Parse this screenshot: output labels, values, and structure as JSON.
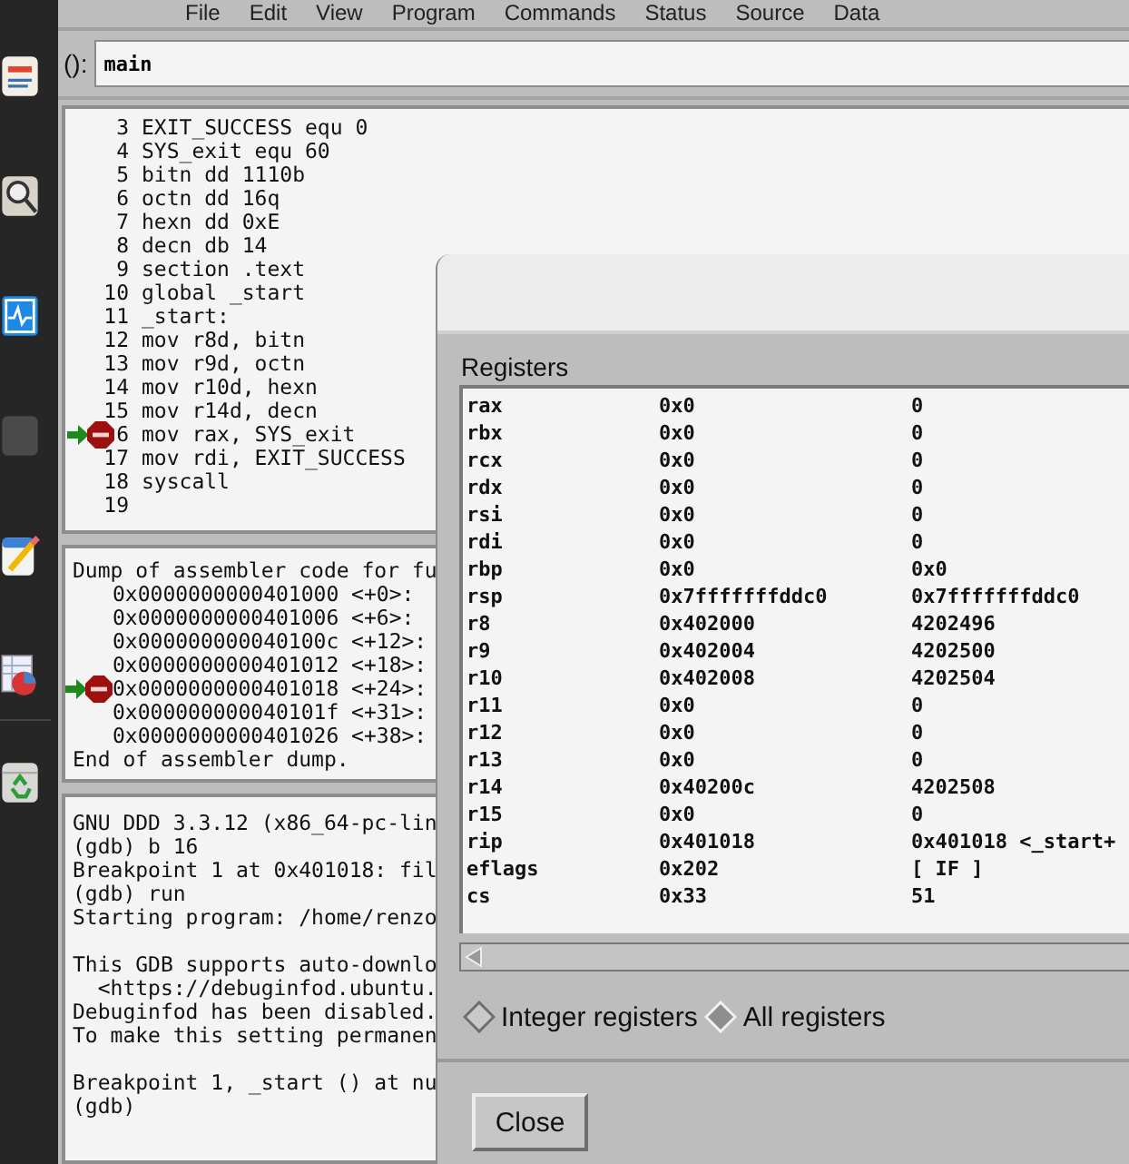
{
  "menu_bar": [
    "File",
    "Edit",
    "View",
    "Program",
    "Commands",
    "Status",
    "Source",
    "Data"
  ],
  "argument_field": {
    "label": "():",
    "value": "main"
  },
  "source_lines": [
    {
      "number": "3",
      "code": "EXIT_SUCCESS equ 0",
      "breakpoint": false,
      "current": false
    },
    {
      "number": "4",
      "code": "SYS_exit equ 60",
      "breakpoint": false,
      "current": false
    },
    {
      "number": "5",
      "code": "bitn dd 1110b",
      "breakpoint": false,
      "current": false
    },
    {
      "number": "6",
      "code": "octn dd 16q",
      "breakpoint": false,
      "current": false
    },
    {
      "number": "7",
      "code": "hexn dd 0xE",
      "breakpoint": false,
      "current": false
    },
    {
      "number": "8",
      "code": "decn db 14",
      "breakpoint": false,
      "current": false
    },
    {
      "number": "9",
      "code": "section .text",
      "breakpoint": false,
      "current": false
    },
    {
      "number": "10",
      "code": "global _start",
      "breakpoint": false,
      "current": false
    },
    {
      "number": "11",
      "code": "_start:",
      "breakpoint": false,
      "current": false
    },
    {
      "number": "12",
      "code": "mov r8d, bitn",
      "breakpoint": false,
      "current": false
    },
    {
      "number": "13",
      "code": "mov r9d, octn",
      "breakpoint": false,
      "current": false
    },
    {
      "number": "14",
      "code": "mov r10d, hexn",
      "breakpoint": false,
      "current": false
    },
    {
      "number": "15",
      "code": "mov r14d, decn",
      "breakpoint": false,
      "current": false
    },
    {
      "number": "6",
      "code": "mov rax, SYS_exit",
      "breakpoint": true,
      "current": true
    },
    {
      "number": "17",
      "code": "mov rdi, EXIT_SUCCESS",
      "breakpoint": false,
      "current": false
    },
    {
      "number": "18",
      "code": "syscall",
      "breakpoint": false,
      "current": false
    },
    {
      "number": "19",
      "breakpoint": false,
      "current": false
    }
  ],
  "assembler_lines": [
    {
      "kind": "text",
      "text": "Dump of assembler code for fu",
      "breakpoint": false,
      "current": false
    },
    {
      "kind": "address",
      "text": "0x0000000000401000 <+0>:",
      "breakpoint": false,
      "current": false
    },
    {
      "kind": "address",
      "text": "0x0000000000401006 <+6>:",
      "breakpoint": false,
      "current": false
    },
    {
      "kind": "address",
      "text": "0x000000000040100c <+12>:",
      "breakpoint": false,
      "current": false
    },
    {
      "kind": "address",
      "text": "0x0000000000401012 <+18>:",
      "breakpoint": false,
      "current": false
    },
    {
      "kind": "address",
      "text": "0x0000000000401018 <+24>:",
      "breakpoint": true,
      "current": true
    },
    {
      "kind": "address",
      "text": "0x000000000040101f <+31>:",
      "breakpoint": false,
      "current": false
    },
    {
      "kind": "address",
      "text": "0x0000000000401026 <+38>:",
      "breakpoint": false,
      "current": false
    },
    {
      "kind": "text",
      "text": "End of assembler dump.",
      "breakpoint": false,
      "current": false
    }
  ],
  "console_blocks": [
    [
      "GNU DDD 3.3.12 (x86_64-pc-lin",
      "(gdb) b 16",
      "Breakpoint 1 at 0x401018: fil",
      "(gdb) run",
      "Starting program: /home/renzo"
    ],
    [
      "This GDB supports auto-downlo",
      "  <https://debuginfod.ubuntu.",
      "Debuginfod has been disabled.",
      "To make this setting permanen"
    ],
    [
      "Breakpoint 1, _start () at nu",
      "(gdb)"
    ]
  ],
  "registers_dialog": {
    "label": "Registers",
    "rows": [
      {
        "name": "rax",
        "hex": "0x0",
        "natural": "0"
      },
      {
        "name": "rbx",
        "hex": "0x0",
        "natural": "0"
      },
      {
        "name": "rcx",
        "hex": "0x0",
        "natural": "0"
      },
      {
        "name": "rdx",
        "hex": "0x0",
        "natural": "0"
      },
      {
        "name": "rsi",
        "hex": "0x0",
        "natural": "0"
      },
      {
        "name": "rdi",
        "hex": "0x0",
        "natural": "0"
      },
      {
        "name": "rbp",
        "hex": "0x0",
        "natural": "0x0"
      },
      {
        "name": "rsp",
        "hex": "0x7fffffffddc0",
        "natural": "0x7fffffffddc0"
      },
      {
        "name": "r8",
        "hex": "0x402000",
        "natural": "4202496"
      },
      {
        "name": "r9",
        "hex": "0x402004",
        "natural": "4202500"
      },
      {
        "name": "r10",
        "hex": "0x402008",
        "natural": "4202504"
      },
      {
        "name": "r11",
        "hex": "0x0",
        "natural": "0"
      },
      {
        "name": "r12",
        "hex": "0x0",
        "natural": "0"
      },
      {
        "name": "r13",
        "hex": "0x0",
        "natural": "0"
      },
      {
        "name": "r14",
        "hex": "0x40200c",
        "natural": "4202508"
      },
      {
        "name": "r15",
        "hex": "0x0",
        "natural": "0"
      },
      {
        "name": "rip",
        "hex": "0x401018",
        "natural": "0x401018 <_start+"
      },
      {
        "name": "eflags",
        "hex": "0x202",
        "natural": "[ IF ]"
      },
      {
        "name": "cs",
        "hex": "0x33",
        "natural": "51"
      }
    ],
    "modes": [
      {
        "label": "Integer registers",
        "selected": false
      },
      {
        "label": "All registers",
        "selected": true
      }
    ],
    "close_button": "Close"
  }
}
